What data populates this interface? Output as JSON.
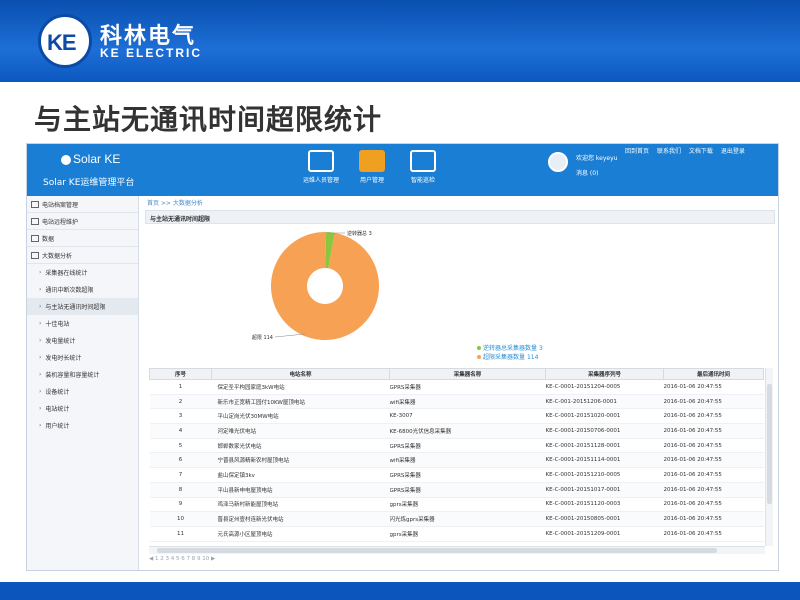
{
  "slide": {
    "brand_logo": "KE",
    "brand_cn": "科林电气",
    "brand_en": "KE ELECTRIC",
    "title": "与主站无通讯时间超限统计"
  },
  "app": {
    "logo_text": "Solar KE",
    "subtitle": "Solar KE运维管理平台",
    "nav": [
      {
        "label": "运维人员管理",
        "icon": "monitor-icon"
      },
      {
        "label": "用户管理",
        "icon": "user-icon"
      },
      {
        "label": "智能巡检",
        "icon": "device-icon"
      }
    ],
    "user": {
      "welcome": "欢迎您 keyeyu",
      "messages": "消息 (0)"
    },
    "top_links": [
      "回到首页",
      "联系我们",
      "文档下载",
      "退出登录"
    ],
    "sidebar": [
      {
        "label": "电站档案管理",
        "level": 1
      },
      {
        "label": "电站远程维护",
        "level": 1
      },
      {
        "label": "数据",
        "level": 1
      },
      {
        "label": "大数据分析",
        "level": 1
      },
      {
        "label": "采集器在线统计",
        "level": 2
      },
      {
        "label": "通讯中断次数超限",
        "level": 2
      },
      {
        "label": "与主站无通讯时间超限",
        "level": 2,
        "active": true
      },
      {
        "label": "十佳电站",
        "level": 2
      },
      {
        "label": "发电量统计",
        "level": 2
      },
      {
        "label": "发电时长统计",
        "level": 2
      },
      {
        "label": "装机容量和容量统计",
        "level": 2
      },
      {
        "label": "设备统计",
        "level": 2
      },
      {
        "label": "电站统计",
        "level": 2
      },
      {
        "label": "用户统计",
        "level": 2
      }
    ],
    "breadcrumb": "首页 >> 大数据分析",
    "panel_title": "与主站无通讯时间超限"
  },
  "chart_data": {
    "type": "pie",
    "slices": [
      {
        "name": "逆转器总采集器数量",
        "value": 3,
        "color": "#8cc63f"
      },
      {
        "name": "超限采集器数量",
        "value": 114,
        "color": "#f7a155"
      }
    ],
    "labels": [
      "逆转器总 3",
      "超限 114"
    ]
  },
  "table": {
    "headers": [
      "序号",
      "电站名称",
      "采集器名称",
      "采集器序列号",
      "最后通讯时间"
    ],
    "rows": [
      [
        "1",
        "保定圣平构园家庭3kW电站",
        "GPRS采集器",
        "KE-C-0001-20151204-0005",
        "2016-01-06 20:47:55"
      ],
      [
        "2",
        "新乐市正宽精工园付10KW屋顶电站",
        "wifi采集器",
        "KE-C-001-20151206-0001",
        "2016-01-06 20:47:55"
      ],
      [
        "3",
        "平山定岗光伏30MW电站",
        "KE-3007",
        "KE-C-0001-20151020-0001",
        "2016-01-06 20:47:55"
      ],
      [
        "4",
        "河定唯光伏电站",
        "KE-6800光伏信息采集器",
        "KE-C-0001-20150706-0001",
        "2016-01-06 20:47:55"
      ],
      [
        "5",
        "邯郸数家光伏电站",
        "GPRS采集器",
        "KE-C-0001-20151128-0001",
        "2016-01-06 20:47:55"
      ],
      [
        "6",
        "宁晋县风源精新农村屋顶电站",
        "wifi采集器",
        "KE-C-0001-20151114-0001",
        "2016-01-06 20:47:55"
      ],
      [
        "7",
        "盐山保定镇3kv",
        "GPRS采集器",
        "KE-C-0001-20151210-0005",
        "2016-01-06 20:47:55"
      ],
      [
        "8",
        "平山县新申电屋顶电站",
        "GPRS采集器",
        "KE-C-0001-20151017-0001",
        "2016-01-06 20:47:55"
      ],
      [
        "9",
        "鸡泽马新村新能屋顶电站",
        "gprs采集器",
        "KE-C-0001-20151120-0003",
        "2016-01-06 20:47:55"
      ],
      [
        "10",
        "晋县定州壹村连新光伏电站",
        "闪光炼gprs采集器",
        "KE-C-0001-20150805-0001",
        "2016-01-06 20:47:55"
      ],
      [
        "11",
        "元氏高源小区屋顶电站",
        "gprs采集器",
        "KE-C-0001-20151209-0001",
        "2016-01-06 20:47:55"
      ]
    ]
  }
}
